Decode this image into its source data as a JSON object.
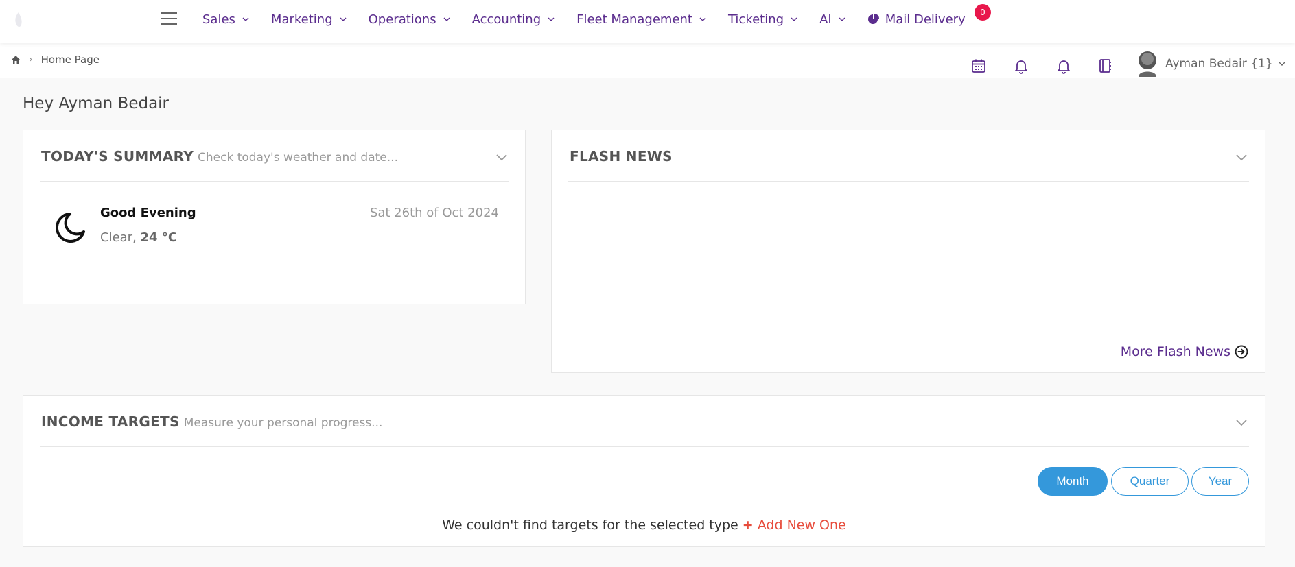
{
  "navbar": {
    "items": [
      {
        "label": "Sales"
      },
      {
        "label": "Marketing"
      },
      {
        "label": "Operations"
      },
      {
        "label": "Accounting"
      },
      {
        "label": "Fleet Management"
      },
      {
        "label": "Ticketing"
      },
      {
        "label": "AI"
      }
    ],
    "mail_label": "Mail Delivery",
    "mail_badge": "0"
  },
  "breadcrumb": {
    "current": "Home Page"
  },
  "user": {
    "name": "Ayman Bedair {1}"
  },
  "greeting": "Hey Ayman Bedair",
  "summary": {
    "title": "TODAY'S SUMMARY",
    "subtitle": "Check today's weather and date...",
    "salutation": "Good Evening",
    "condition": "Clear, ",
    "temperature": "24 °C",
    "date": "Sat 26th of Oct 2024"
  },
  "flash_news": {
    "title": "FLASH NEWS",
    "more_label": "More Flash News"
  },
  "income_targets": {
    "title": "INCOME TARGETS",
    "subtitle": "Measure your personal progress...",
    "periods": [
      "Month",
      "Quarter",
      "Year"
    ],
    "selected_period": "Month",
    "empty_message": "We couldn't find targets for the selected type",
    "add_label": "Add New One"
  },
  "colors": {
    "brand": "#5b2d8e",
    "accent": "#3498db",
    "danger": "#e74c3c",
    "badge": "#e8174b"
  }
}
